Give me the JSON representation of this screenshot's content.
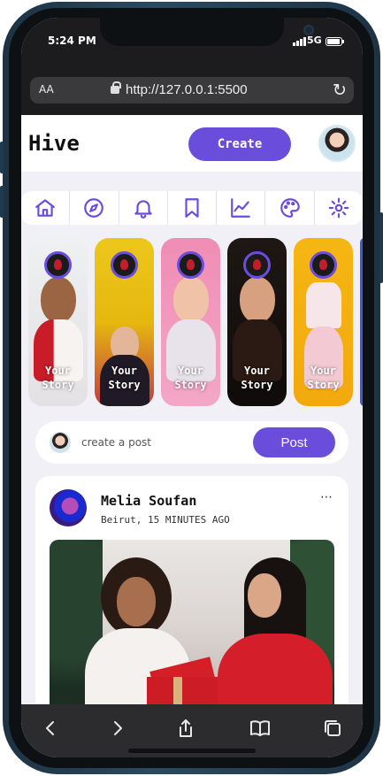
{
  "status_bar": {
    "time": "5:24 PM",
    "network": "5G",
    "battery_level": 0.95
  },
  "browser": {
    "text_size_label": "AA",
    "url": "http://127.0.0.1:5500"
  },
  "app": {
    "title": "Hive",
    "create_label": "Create"
  },
  "nav_icons": [
    "home-icon",
    "compass-icon",
    "bell-icon",
    "bookmark-icon",
    "chart-icon",
    "palette-icon",
    "gear-icon"
  ],
  "stories": [
    {
      "line1": "Your",
      "line2": "Story"
    },
    {
      "line1": "Your",
      "line2": "Story"
    },
    {
      "line1": "Your",
      "line2": "Story"
    },
    {
      "line1": "Your",
      "line2": "Story"
    },
    {
      "line1": "Your",
      "line2": "Story"
    }
  ],
  "composer": {
    "placeholder": "create a post",
    "post_label": "Post"
  },
  "feed": [
    {
      "author": "Melia Soufan",
      "location": "Beirut",
      "time": "15 MINUTES AGO",
      "meta": "Beirut, 15 MINUTES AGO",
      "more": "⋯"
    }
  ],
  "colors": {
    "accent": "#6b4ddb",
    "background": "#f1f0f6"
  }
}
